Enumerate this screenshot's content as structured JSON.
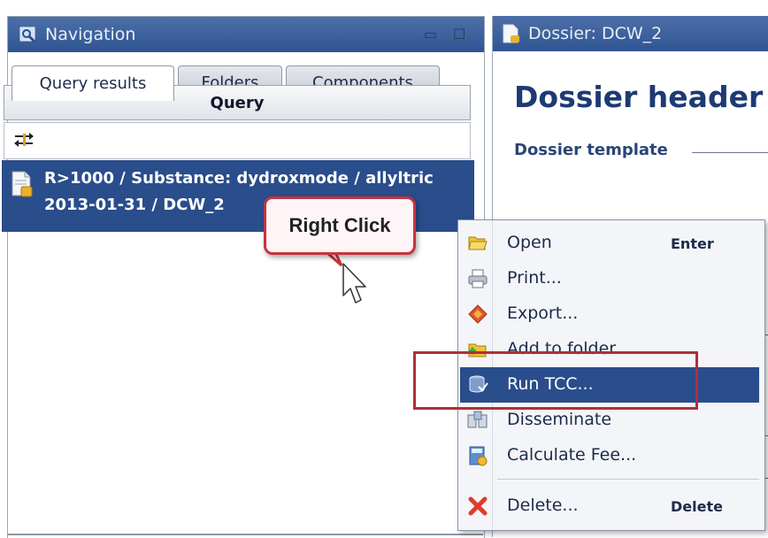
{
  "navigation": {
    "title": "Navigation",
    "minimize_glyph": "▭",
    "maximize_glyph": "☐",
    "tabs": [
      {
        "label": "Query results",
        "active": true
      },
      {
        "label": "Folders",
        "active": false
      },
      {
        "label": "Components",
        "active": false
      }
    ],
    "query_button_label": "Query",
    "result_line1": "R>1000 / Substance: dydroxmode / allyltric",
    "result_line2": "2013-01-31 / DCW_2"
  },
  "dossier": {
    "title": "Dossier: DCW_2",
    "header": "Dossier header",
    "template_label": "Dossier template"
  },
  "callout": {
    "text": "Right Click"
  },
  "context_menu": {
    "items": [
      {
        "label": "Open",
        "shortcut": "Enter",
        "icon": "folder-open-icon"
      },
      {
        "label": "Print...",
        "shortcut": "",
        "icon": "printer-icon"
      },
      {
        "label": "Export...",
        "shortcut": "",
        "icon": "export-icon"
      },
      {
        "label": "Add to folder...",
        "shortcut": "",
        "icon": "add-folder-icon"
      },
      {
        "label": "Run TCC...",
        "shortcut": "",
        "icon": "run-tcc-icon",
        "highlighted": true
      },
      {
        "label": "Disseminate",
        "shortcut": "",
        "icon": "disseminate-icon"
      },
      {
        "label": "Calculate Fee...",
        "shortcut": "",
        "icon": "calculate-fee-icon"
      },
      {
        "label": "Delete...",
        "shortcut": "Delete",
        "icon": "delete-icon"
      }
    ]
  },
  "colors": {
    "title_bar": "#2f5592",
    "selection": "#2a4d8b",
    "callout_border": "#c8323e",
    "highlight_box": "#b02f37"
  }
}
